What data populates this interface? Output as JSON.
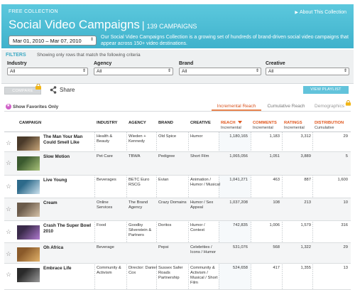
{
  "header": {
    "collection_label": "FREE COLLECTION",
    "about_link": "About This Collection",
    "title": "Social Video Campaigns",
    "separator": "|",
    "count": "139 CAMPAIGNS",
    "date_range": "Mar 01, 2010 – Mar 07, 2010",
    "description": "Our Social Video Campaigns Collection is a growing set of hundreds of brand-driven social video campaigns that appear across 150+ video destinations."
  },
  "filters": {
    "title": "FILTERS",
    "note": "Showing only rows that match the following criteria",
    "groups": [
      {
        "label": "Industry",
        "value": "All"
      },
      {
        "label": "Agency",
        "value": "All"
      },
      {
        "label": "Brand",
        "value": "All"
      },
      {
        "label": "Creative",
        "value": "All"
      }
    ]
  },
  "toolbar": {
    "compare_label": "COMPARE",
    "share_label": "Share",
    "view_playlist_label": "VIEW PLAYLIST"
  },
  "favorites": {
    "label": "Show Favorites Only"
  },
  "tabs": {
    "incremental": "Incremental Reach",
    "cumulative": "Cumulative Reach",
    "demographics": "Demographics"
  },
  "table": {
    "headers": {
      "campaign": "CAMPAIGN",
      "industry": "INDUSTRY",
      "agency": "AGENCY",
      "brand": "BRAND",
      "creative": "CREATIVE",
      "reach": "REACH",
      "reach_sub": "Incremental",
      "comments": "COMMENTS",
      "comments_sub": "Incremental",
      "ratings": "RATINGS",
      "ratings_sub": "Incremental",
      "distribution": "DISTRIBUTION",
      "distribution_sub": "Cumulative"
    },
    "rows": [
      {
        "campaign": "The Man Your Man Could Smell Like",
        "industry": "Health & Beauty",
        "agency": "Wieden + Kennedy",
        "brand": "Old Spice",
        "creative": "Humor",
        "reach": "1,180,165",
        "comments": "1,183",
        "ratings": "3,312",
        "distribution": "29"
      },
      {
        "campaign": "Slow Motion",
        "industry": "Pet Care",
        "agency": "TBWA",
        "brand": "Pedigree",
        "creative": "Short Film",
        "reach": "1,065,056",
        "comments": "1,051",
        "ratings": "3,889",
        "distribution": "5"
      },
      {
        "campaign": "Live Young",
        "industry": "Beverages",
        "agency": "BETC Euro RSCG",
        "brand": "Evian",
        "creative": "Animation / Humor / Musical",
        "reach": "1,041,271",
        "comments": "463",
        "ratings": "887",
        "distribution": "1,600"
      },
      {
        "campaign": "Cream",
        "industry": "Online Services",
        "agency": "The Brand Agency",
        "brand": "Crazy Domains",
        "creative": "Humor / Sex Appeal",
        "reach": "1,037,208",
        "comments": "108",
        "ratings": "213",
        "distribution": "10"
      },
      {
        "campaign": "Crash The Super Bowl 2010",
        "industry": "Food",
        "agency": "Goodby Silverstein & Partners",
        "brand": "Doritos",
        "creative": "Humor / Contest",
        "reach": "742,835",
        "comments": "1,006",
        "ratings": "1,579",
        "distribution": "316"
      },
      {
        "campaign": "Oh Africa",
        "industry": "Beverage",
        "agency": "",
        "brand": "Pepsi",
        "creative": "Celebrities / Icons / Humor",
        "reach": "531,076",
        "comments": "568",
        "ratings": "1,322",
        "distribution": "29"
      },
      {
        "campaign": "Embrace Life",
        "industry": "Community & Activism",
        "agency": "Director: Daniel Cox",
        "brand": "Sussex Safer Roads Partnership",
        "creative": "Community & Activism / Musical / Short Film",
        "reach": "524,658",
        "comments": "417",
        "ratings": "1,355",
        "distribution": "13"
      }
    ]
  },
  "colors": {
    "header_bg": "#4cbed6",
    "accent_orange": "#e0561c",
    "filter_title": "#3eaac4",
    "view_playlist_bg": "#62c3db",
    "favorites_icon": "#d060c8"
  }
}
